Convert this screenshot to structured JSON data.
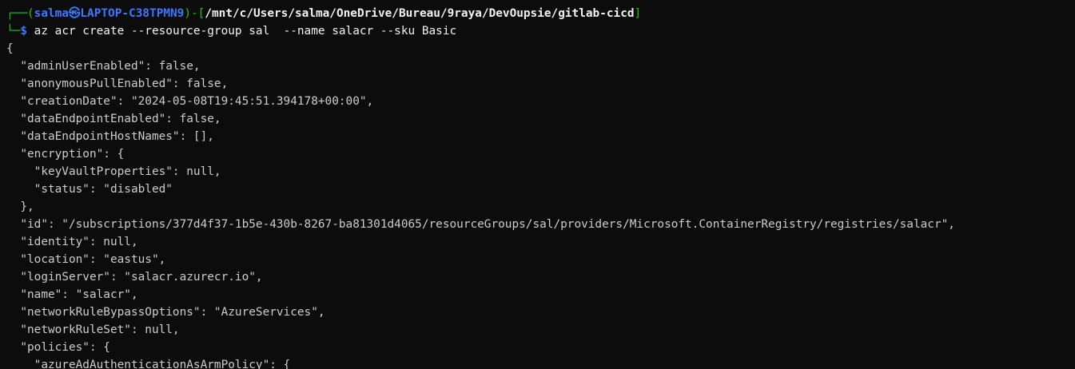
{
  "prompt": {
    "frame_top": "┌──(",
    "user": "salma",
    "at_symbol": "㉿",
    "host": "LAPTOP-C38TPMN9",
    "sep": ")-[",
    "path": "/mnt/c/Users/salma/OneDrive/Bureau/9raya/DevOupsie/gitlab-cicd",
    "close": "]",
    "frame_bottom": "└─",
    "dollar": "$",
    "command": " az acr create --resource-group sal  --name salacr --sku Basic"
  },
  "output_lines": [
    "{",
    "  \"adminUserEnabled\": false,",
    "  \"anonymousPullEnabled\": false,",
    "  \"creationDate\": \"2024-05-08T19:45:51.394178+00:00\",",
    "  \"dataEndpointEnabled\": false,",
    "  \"dataEndpointHostNames\": [],",
    "  \"encryption\": {",
    "    \"keyVaultProperties\": null,",
    "    \"status\": \"disabled\"",
    "  },",
    "  \"id\": \"/subscriptions/377d4f37-1b5e-430b-8267-ba81301d4065/resourceGroups/sal/providers/Microsoft.ContainerRegistry/registries/salacr\",",
    "  \"identity\": null,",
    "  \"location\": \"eastus\",",
    "  \"loginServer\": \"salacr.azurecr.io\",",
    "  \"name\": \"salacr\",",
    "  \"networkRuleBypassOptions\": \"AzureServices\",",
    "  \"networkRuleSet\": null,",
    "  \"policies\": {",
    "    \"azureAdAuthenticationAsArmPolicy\": {"
  ]
}
